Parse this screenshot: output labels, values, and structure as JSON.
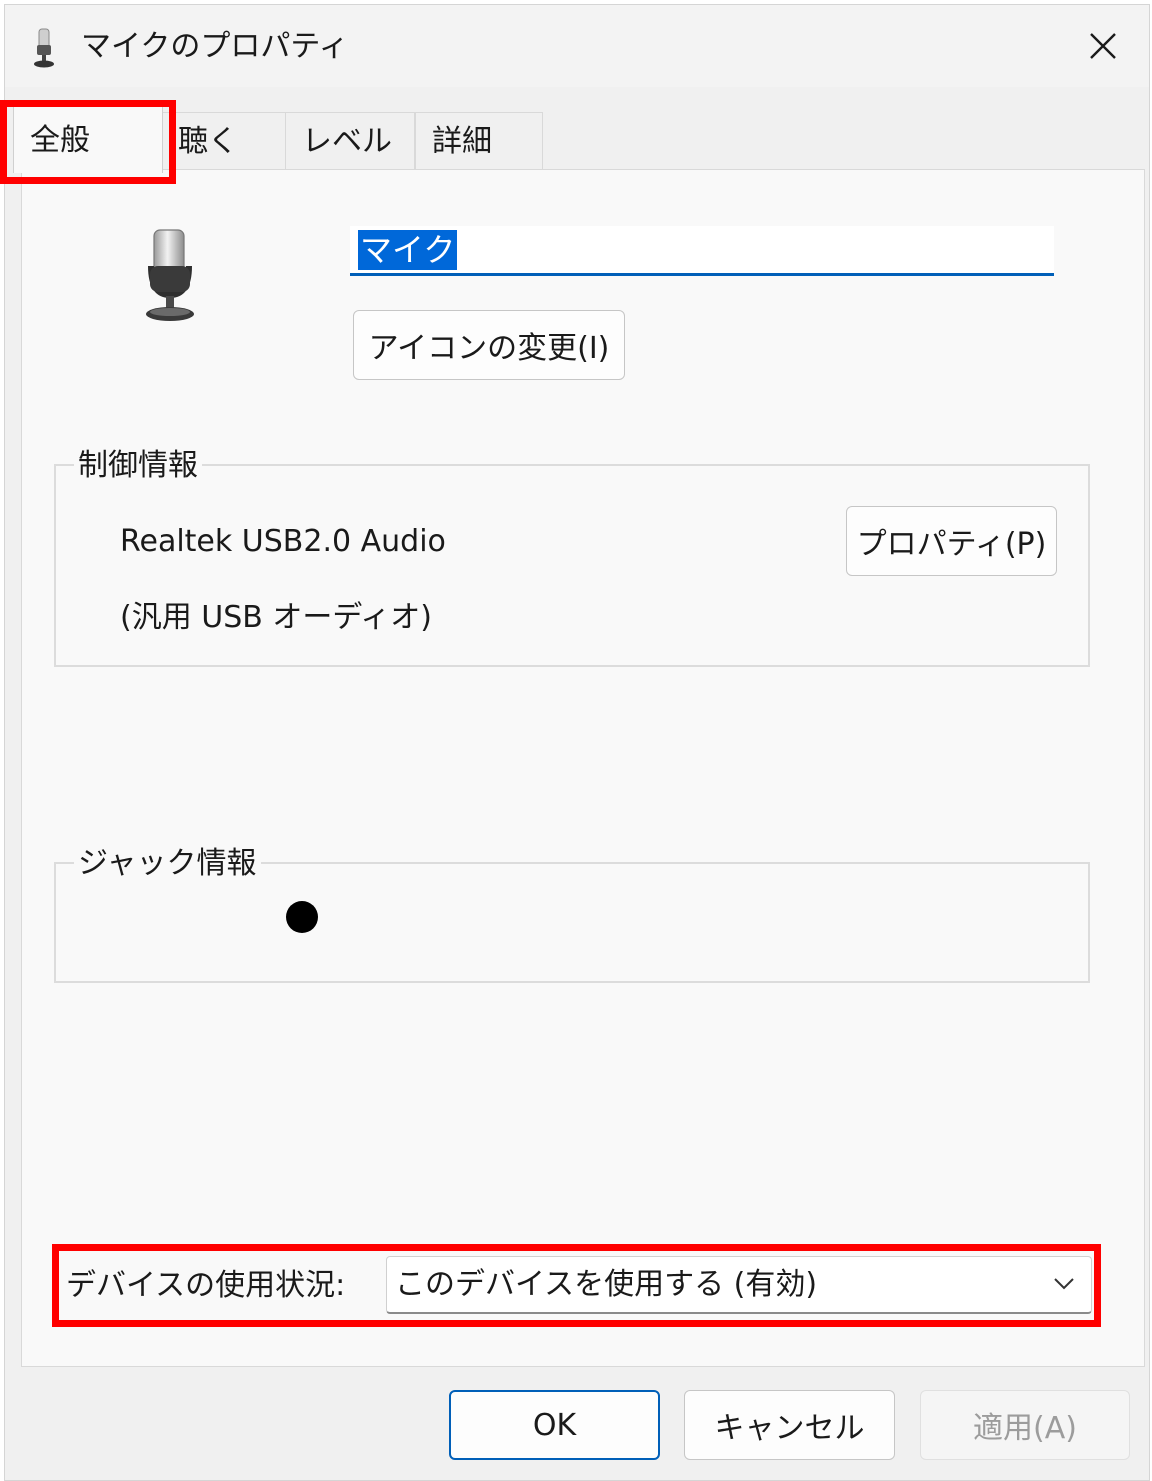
{
  "window": {
    "title": "マイクのプロパティ"
  },
  "tabs": [
    {
      "label": "全般",
      "active": true
    },
    {
      "label": "聴く",
      "active": false
    },
    {
      "label": "レベル",
      "active": false
    },
    {
      "label": "詳細",
      "active": false
    }
  ],
  "general": {
    "device_name": "マイク",
    "change_icon_label": "アイコンの変更(I)",
    "controller": {
      "legend": "制御情報",
      "device_line": "Realtek USB2.0 Audio",
      "driver_line": "(汎用 USB オーディオ)",
      "properties_label": "プロパティ(P)"
    },
    "jack": {
      "legend": "ジャック情報"
    },
    "usage": {
      "label": "デバイスの使用状況:",
      "selected": "このデバイスを使用する (有効)"
    }
  },
  "footer": {
    "ok_label": "OK",
    "cancel_label": "キャンセル",
    "apply_label": "適用(A)"
  },
  "colors": {
    "accent": "#005fb8",
    "highlight": "#ff0000",
    "selection": "#0068d9"
  }
}
